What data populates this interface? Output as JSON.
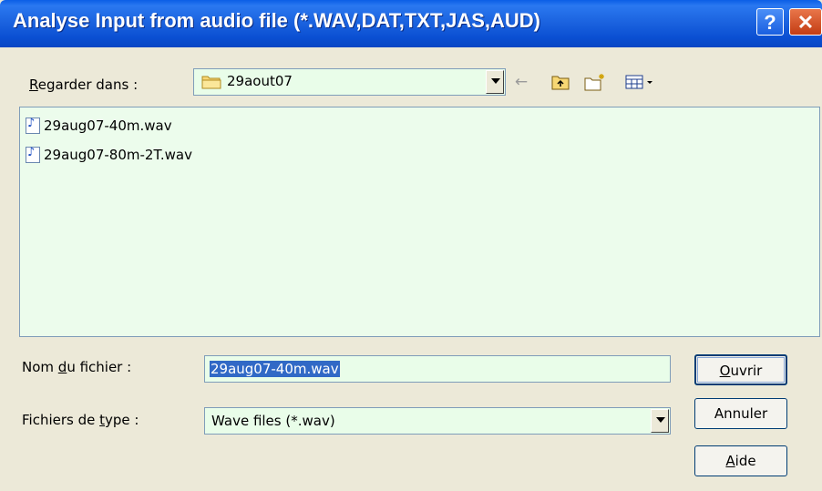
{
  "window": {
    "title": "Analyse Input from audio file (*.WAV,DAT,TXT,JAS,AUD)",
    "help_label": "?",
    "close_label": "✕"
  },
  "lookin": {
    "label_underline": "R",
    "label_rest": "egarder dans :",
    "folder": "29aout07"
  },
  "toolbar": {
    "icons": [
      "back-arrow-icon",
      "up-folder-icon",
      "new-folder-icon",
      "view-menu-icon"
    ]
  },
  "files": [
    {
      "name": "29aug07-40m.wav",
      "icon": "audio-file-icon"
    },
    {
      "name": "29aug07-80m-2T.wav",
      "icon": "audio-file-icon"
    }
  ],
  "filename": {
    "label_pre": "Nom ",
    "label_underline": "d",
    "label_post": "u fichier :",
    "value": "29aug07-40m.wav"
  },
  "filetype": {
    "label_pre": "Fichiers de ",
    "label_underline": "t",
    "label_post": "ype :",
    "value": "Wave files (*.wav)"
  },
  "buttons": {
    "open_underline": "O",
    "open_rest": "uvrir",
    "cancel": "Annuler",
    "help_underline": "A",
    "help_rest": "ide"
  },
  "colors": {
    "titlebar": "#0a4fd2",
    "field_bg": "#e9fde9",
    "selection": "#3169c6"
  }
}
